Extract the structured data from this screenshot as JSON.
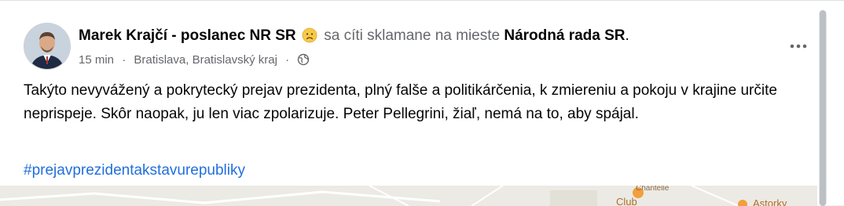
{
  "post": {
    "author": "Marek Krajčí - poslanec NR SR",
    "feeling_text": "sa cíti sklamane na mieste",
    "location_name": "Národná rada SR",
    "location_suffix": ".",
    "timestamp": "15 min",
    "separator": "·",
    "place": "Bratislava, Bratislavský kraj",
    "privacy_icon": "globe-icon",
    "more_icon": "more-options-icon",
    "body": "Takýto nevyvážený a pokrytecký prejav prezidenta, plný falše a politikárčenia, k zmiereniu a pokoju v krajine určite neprispeje. Skôr naopak, ju len viac zpolarizuje. Peter Pellegrini, žiaľ, nemá na to, aby spájal.",
    "hashtag": "#prejavprezidentakstavurepubliky"
  },
  "map": {
    "label_club": "Club",
    "label_partial": "Chantelle",
    "label_right": "Astorky"
  },
  "colors": {
    "link": "#216fdb",
    "secondary_text": "#65676b",
    "primary_text": "#050505"
  }
}
